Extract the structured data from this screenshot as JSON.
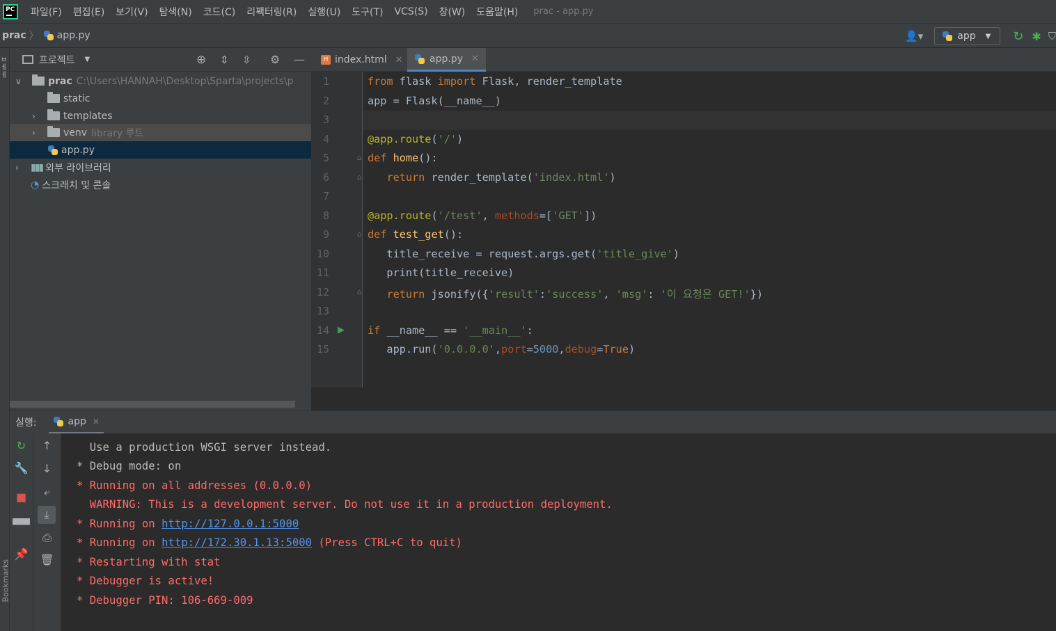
{
  "menu": [
    "파일(F)",
    "편집(E)",
    "보기(V)",
    "탐색(N)",
    "코드(C)",
    "리팩터링(R)",
    "실행(U)",
    "도구(T)",
    "VCS(S)",
    "창(W)",
    "도움말(H)"
  ],
  "window_title": "prac - app.py",
  "breadcrumb": {
    "root": "prac",
    "file": "app.py"
  },
  "run_config": "app",
  "colors": {
    "accent": "#4a88c7",
    "keyword": "#cc7832",
    "string": "#6a8759",
    "decorator": "#bbb529",
    "number": "#6897bb",
    "error_text": "#ff6b68",
    "link": "#5394ec",
    "selection": "#0d293e"
  },
  "project": {
    "title": "프로젝트",
    "root_name": "prac",
    "root_path": "C:\\Users\\HANNAH\\Desktop\\Sparta\\projects\\p",
    "items": [
      {
        "label": "static",
        "hint": ""
      },
      {
        "label": "templates",
        "hint": ""
      },
      {
        "label": "venv",
        "hint": "library 루트"
      },
      {
        "label": "app.py",
        "hint": ""
      }
    ],
    "external_libs": "외부 라이브러리",
    "scratches": "스크래치 및 콘솔"
  },
  "tabs": [
    {
      "label": "index.html"
    },
    {
      "label": "app.py"
    }
  ],
  "code_lines": [
    "from flask import Flask, render_template",
    "app = Flask(__name__)",
    "",
    "@app.route('/')",
    "def home():",
    "   return render_template('index.html')",
    "",
    "@app.route('/test', methods=['GET'])",
    "def test_get():",
    "   title_receive = request.args.get('title_give')",
    "   print(title_receive)",
    "   return jsonify({'result':'success', 'msg': '이 요청은 GET!'})",
    "",
    "if __name__ == '__main__':",
    "   app.run('0.0.0.0',port=5000,debug=True)"
  ],
  "line_numbers": [
    "1",
    "2",
    "3",
    "4",
    "5",
    "6",
    "7",
    "8",
    "9",
    "10",
    "11",
    "12",
    "13",
    "14",
    "15"
  ],
  "run_panel": {
    "label": "실행:",
    "tab": "app"
  },
  "console": {
    "line1": "  Use a production WSGI server instead.",
    "line2": "* Debug mode: on",
    "line3": "* Running on all addresses (0.0.0.0)",
    "line4": "  WARNING: This is a development server. Do not use it in a production deployment.",
    "line5_prefix": "* Running on ",
    "line5_link": "http://127.0.0.1:5000",
    "line6_prefix": "* Running on ",
    "line6_link": "http://172.30.1.13:5000",
    "line6_suffix": " (Press CTRL+C to quit)",
    "line7": "* Restarting with stat",
    "line8": "* Debugger is active!",
    "line9": "* Debugger PIN: 106-669-009"
  },
  "side_labels": {
    "bookmarks": "Bookmarks"
  }
}
